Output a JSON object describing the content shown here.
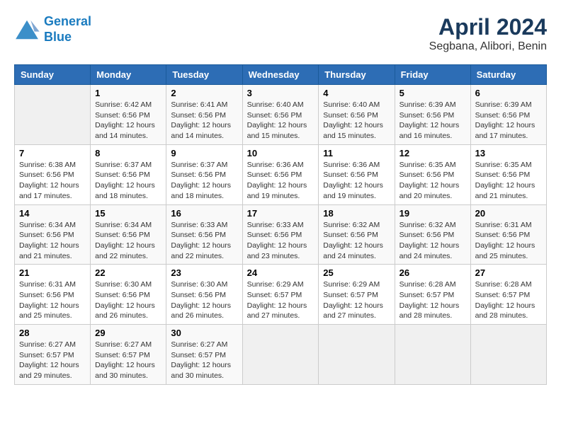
{
  "logo": {
    "line1": "General",
    "line2": "Blue"
  },
  "title": "April 2024",
  "subtitle": "Segbana, Alibori, Benin",
  "days_of_week": [
    "Sunday",
    "Monday",
    "Tuesday",
    "Wednesday",
    "Thursday",
    "Friday",
    "Saturday"
  ],
  "weeks": [
    [
      {
        "num": "",
        "info": ""
      },
      {
        "num": "1",
        "info": "Sunrise: 6:42 AM\nSunset: 6:56 PM\nDaylight: 12 hours\nand 14 minutes."
      },
      {
        "num": "2",
        "info": "Sunrise: 6:41 AM\nSunset: 6:56 PM\nDaylight: 12 hours\nand 14 minutes."
      },
      {
        "num": "3",
        "info": "Sunrise: 6:40 AM\nSunset: 6:56 PM\nDaylight: 12 hours\nand 15 minutes."
      },
      {
        "num": "4",
        "info": "Sunrise: 6:40 AM\nSunset: 6:56 PM\nDaylight: 12 hours\nand 15 minutes."
      },
      {
        "num": "5",
        "info": "Sunrise: 6:39 AM\nSunset: 6:56 PM\nDaylight: 12 hours\nand 16 minutes."
      },
      {
        "num": "6",
        "info": "Sunrise: 6:39 AM\nSunset: 6:56 PM\nDaylight: 12 hours\nand 17 minutes."
      }
    ],
    [
      {
        "num": "7",
        "info": "Sunrise: 6:38 AM\nSunset: 6:56 PM\nDaylight: 12 hours\nand 17 minutes."
      },
      {
        "num": "8",
        "info": "Sunrise: 6:37 AM\nSunset: 6:56 PM\nDaylight: 12 hours\nand 18 minutes."
      },
      {
        "num": "9",
        "info": "Sunrise: 6:37 AM\nSunset: 6:56 PM\nDaylight: 12 hours\nand 18 minutes."
      },
      {
        "num": "10",
        "info": "Sunrise: 6:36 AM\nSunset: 6:56 PM\nDaylight: 12 hours\nand 19 minutes."
      },
      {
        "num": "11",
        "info": "Sunrise: 6:36 AM\nSunset: 6:56 PM\nDaylight: 12 hours\nand 19 minutes."
      },
      {
        "num": "12",
        "info": "Sunrise: 6:35 AM\nSunset: 6:56 PM\nDaylight: 12 hours\nand 20 minutes."
      },
      {
        "num": "13",
        "info": "Sunrise: 6:35 AM\nSunset: 6:56 PM\nDaylight: 12 hours\nand 21 minutes."
      }
    ],
    [
      {
        "num": "14",
        "info": "Sunrise: 6:34 AM\nSunset: 6:56 PM\nDaylight: 12 hours\nand 21 minutes."
      },
      {
        "num": "15",
        "info": "Sunrise: 6:34 AM\nSunset: 6:56 PM\nDaylight: 12 hours\nand 22 minutes."
      },
      {
        "num": "16",
        "info": "Sunrise: 6:33 AM\nSunset: 6:56 PM\nDaylight: 12 hours\nand 22 minutes."
      },
      {
        "num": "17",
        "info": "Sunrise: 6:33 AM\nSunset: 6:56 PM\nDaylight: 12 hours\nand 23 minutes."
      },
      {
        "num": "18",
        "info": "Sunrise: 6:32 AM\nSunset: 6:56 PM\nDaylight: 12 hours\nand 24 minutes."
      },
      {
        "num": "19",
        "info": "Sunrise: 6:32 AM\nSunset: 6:56 PM\nDaylight: 12 hours\nand 24 minutes."
      },
      {
        "num": "20",
        "info": "Sunrise: 6:31 AM\nSunset: 6:56 PM\nDaylight: 12 hours\nand 25 minutes."
      }
    ],
    [
      {
        "num": "21",
        "info": "Sunrise: 6:31 AM\nSunset: 6:56 PM\nDaylight: 12 hours\nand 25 minutes."
      },
      {
        "num": "22",
        "info": "Sunrise: 6:30 AM\nSunset: 6:56 PM\nDaylight: 12 hours\nand 26 minutes."
      },
      {
        "num": "23",
        "info": "Sunrise: 6:30 AM\nSunset: 6:56 PM\nDaylight: 12 hours\nand 26 minutes."
      },
      {
        "num": "24",
        "info": "Sunrise: 6:29 AM\nSunset: 6:57 PM\nDaylight: 12 hours\nand 27 minutes."
      },
      {
        "num": "25",
        "info": "Sunrise: 6:29 AM\nSunset: 6:57 PM\nDaylight: 12 hours\nand 27 minutes."
      },
      {
        "num": "26",
        "info": "Sunrise: 6:28 AM\nSunset: 6:57 PM\nDaylight: 12 hours\nand 28 minutes."
      },
      {
        "num": "27",
        "info": "Sunrise: 6:28 AM\nSunset: 6:57 PM\nDaylight: 12 hours\nand 28 minutes."
      }
    ],
    [
      {
        "num": "28",
        "info": "Sunrise: 6:27 AM\nSunset: 6:57 PM\nDaylight: 12 hours\nand 29 minutes."
      },
      {
        "num": "29",
        "info": "Sunrise: 6:27 AM\nSunset: 6:57 PM\nDaylight: 12 hours\nand 30 minutes."
      },
      {
        "num": "30",
        "info": "Sunrise: 6:27 AM\nSunset: 6:57 PM\nDaylight: 12 hours\nand 30 minutes."
      },
      {
        "num": "",
        "info": ""
      },
      {
        "num": "",
        "info": ""
      },
      {
        "num": "",
        "info": ""
      },
      {
        "num": "",
        "info": ""
      }
    ]
  ]
}
